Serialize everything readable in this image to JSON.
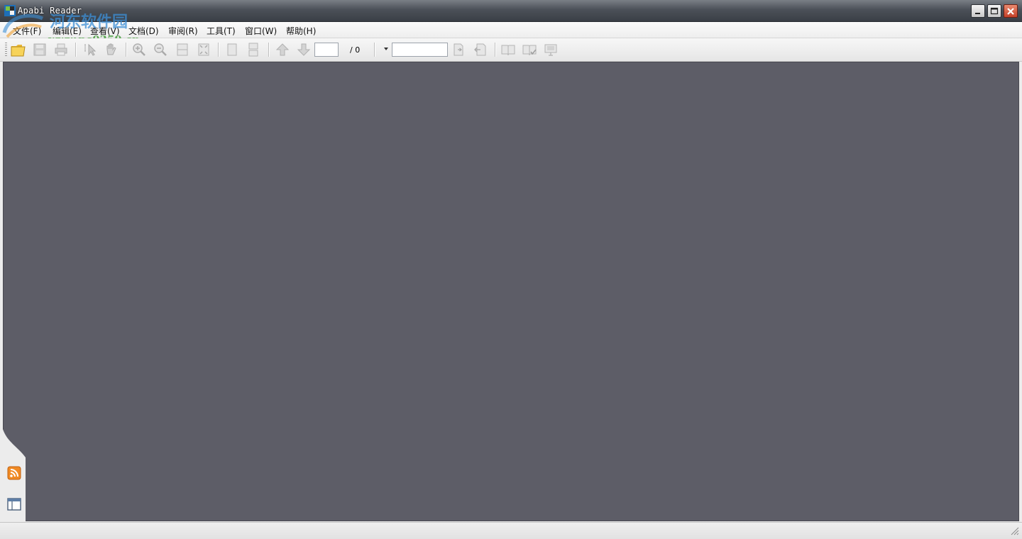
{
  "window": {
    "title": "Apabi Reader"
  },
  "watermark": {
    "text_cn": "河东软件园",
    "url": "www.pc0359.cn"
  },
  "menu": [
    {
      "label": "文件(F)"
    },
    {
      "label": "编辑(E)"
    },
    {
      "label": "查看(V)"
    },
    {
      "label": "文档(D)"
    },
    {
      "label": "审阅(R)"
    },
    {
      "label": "工具(T)"
    },
    {
      "label": "窗口(W)"
    },
    {
      "label": "帮助(H)"
    }
  ],
  "toolbar": {
    "page_input": "",
    "page_total": "/ 0",
    "zoom_input": ""
  },
  "colors": {
    "doc_background": "#5d5d67",
    "rss_accent": "#f08a24"
  }
}
